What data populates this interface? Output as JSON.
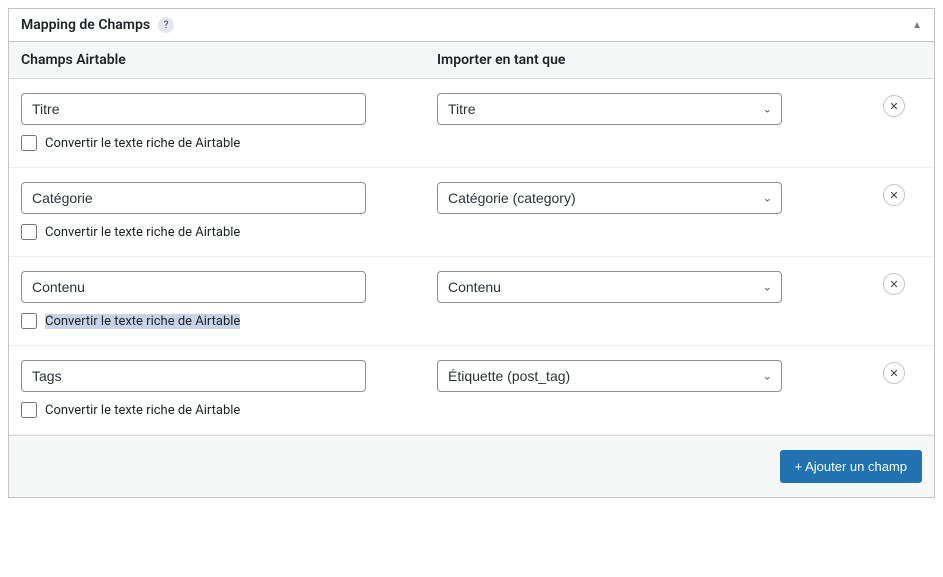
{
  "panel": {
    "title": "Mapping de Champs",
    "help_icon": "?",
    "collapse_icon": "▲"
  },
  "headers": {
    "airtable_fields": "Champs Airtable",
    "import_as": "Importer en tant que"
  },
  "rows": [
    {
      "field": "Titre",
      "import_as": "Titre",
      "convert_label": "Convertir le texte riche de Airtable",
      "convert_highlighted": false
    },
    {
      "field": "Catégorie",
      "import_as": "Catégorie (category)",
      "convert_label": "Convertir le texte riche de Airtable",
      "convert_highlighted": false
    },
    {
      "field": "Contenu",
      "import_as": "Contenu",
      "convert_label": "Convertir le texte riche de Airtable",
      "convert_highlighted": true
    },
    {
      "field": "Tags",
      "import_as": "Étiquette (post_tag)",
      "convert_label": "Convertir le texte riche de Airtable",
      "convert_highlighted": false
    }
  ],
  "remove_icon": "✕",
  "footer": {
    "add_label": "+ Ajouter un champ"
  }
}
